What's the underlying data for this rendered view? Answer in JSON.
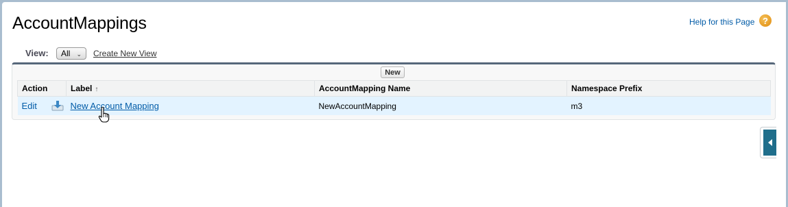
{
  "page": {
    "title": "AccountMappings",
    "help_link": "Help for this Page",
    "help_icon": "?"
  },
  "view": {
    "label": "View:",
    "selected": "All",
    "create_link": "Create New View"
  },
  "list": {
    "new_button": "New",
    "columns": {
      "action": "Action",
      "label": "Label",
      "label_sort_indicator": "↑",
      "name": "AccountMapping Name",
      "namespace": "Namespace Prefix"
    },
    "rows": [
      {
        "action": "Edit",
        "label": "New Account Mapping",
        "name": "NewAccountMapping",
        "namespace": "m3"
      }
    ]
  },
  "colors": {
    "link": "#015ba7",
    "panel_top_border": "#56677a",
    "row_highlight": "#e3f3ff",
    "side_tab": "#1f6e8b"
  }
}
